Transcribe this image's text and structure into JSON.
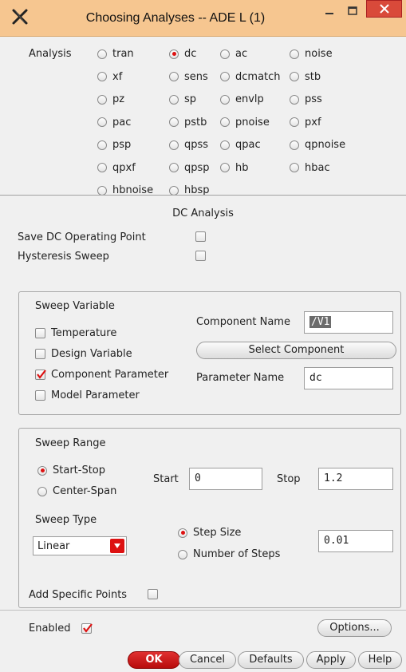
{
  "window": {
    "title": "Choosing Analyses -- ADE L (1)"
  },
  "analysis": {
    "label": "Analysis",
    "options": [
      {
        "label": "tran",
        "selected": false
      },
      {
        "label": "dc",
        "selected": true
      },
      {
        "label": "ac",
        "selected": false
      },
      {
        "label": "noise",
        "selected": false
      },
      {
        "label": "xf",
        "selected": false
      },
      {
        "label": "sens",
        "selected": false
      },
      {
        "label": "dcmatch",
        "selected": false
      },
      {
        "label": "stb",
        "selected": false
      },
      {
        "label": "pz",
        "selected": false
      },
      {
        "label": "sp",
        "selected": false
      },
      {
        "label": "envlp",
        "selected": false
      },
      {
        "label": "pss",
        "selected": false
      },
      {
        "label": "pac",
        "selected": false
      },
      {
        "label": "pstb",
        "selected": false
      },
      {
        "label": "pnoise",
        "selected": false
      },
      {
        "label": "pxf",
        "selected": false
      },
      {
        "label": "psp",
        "selected": false
      },
      {
        "label": "qpss",
        "selected": false
      },
      {
        "label": "qpac",
        "selected": false
      },
      {
        "label": "qpnoise",
        "selected": false
      },
      {
        "label": "qpxf",
        "selected": false
      },
      {
        "label": "qpsp",
        "selected": false
      },
      {
        "label": "hb",
        "selected": false
      },
      {
        "label": "hbac",
        "selected": false
      },
      {
        "label": "hbnoise",
        "selected": false
      },
      {
        "label": "hbsp",
        "selected": false
      }
    ]
  },
  "dc": {
    "heading": "DC Analysis",
    "save_dc_op_label": "Save DC Operating Point",
    "save_dc_op_checked": false,
    "hysteresis_label": "Hysteresis Sweep",
    "hysteresis_checked": false
  },
  "sweep_variable": {
    "heading": "Sweep Variable",
    "temperature": "Temperature",
    "design_variable": "Design Variable",
    "component_parameter": "Component Parameter",
    "model_parameter": "Model Parameter",
    "component_parameter_checked": true,
    "component_name_label": "Component Name",
    "component_name_value": "/V1",
    "select_component_label": "Select Component",
    "parameter_name_label": "Parameter Name",
    "parameter_name_value": "dc"
  },
  "sweep_range": {
    "heading": "Sweep Range",
    "start_stop": "Start-Stop",
    "center_span": "Center-Span",
    "start_stop_selected": true,
    "start_label": "Start",
    "start_value": "0",
    "stop_label": "Stop",
    "stop_value": "1.2",
    "sweep_type_label": "Sweep Type",
    "sweep_type_value": "Linear",
    "step_size": "Step Size",
    "number_of_steps": "Number of Steps",
    "step_size_selected": true,
    "step_value": "0.01",
    "add_specific_points_label": "Add Specific Points",
    "add_specific_points_checked": false
  },
  "footer": {
    "enabled_label": "Enabled",
    "enabled_checked": true,
    "options_label": "Options...",
    "ok_label": "OK",
    "cancel_label": "Cancel",
    "defaults_label": "Defaults",
    "apply_label": "Apply",
    "help_label": "Help"
  },
  "colors": {
    "titlebar": "#f6c690",
    "accent_red": "#d11111",
    "close_button": "#d94a3a"
  }
}
